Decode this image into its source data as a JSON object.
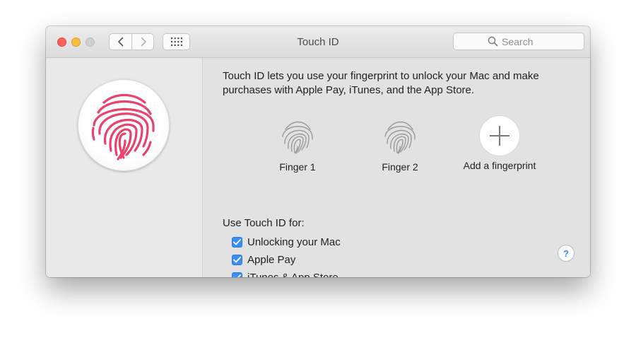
{
  "window": {
    "title": "Touch ID"
  },
  "toolbar": {
    "back_icon": "chevron-left-icon",
    "forward_icon": "chevron-right-icon",
    "grid_icon": "grid-icon"
  },
  "search": {
    "placeholder": "Search"
  },
  "main": {
    "description": "Touch ID lets you use your fingerprint to unlock your Mac and make purchases with Apple Pay, iTunes, and the App Store.",
    "fingerprints": [
      {
        "label": "Finger 1"
      },
      {
        "label": "Finger 2"
      }
    ],
    "add_label": "Add a fingerprint",
    "use_label": "Use Touch ID for:",
    "options": [
      {
        "label": "Unlocking your Mac",
        "checked": true
      },
      {
        "label": "Apple Pay",
        "checked": true
      },
      {
        "label": "iTunes & App Store",
        "checked": true
      }
    ],
    "help_label": "?"
  },
  "colors": {
    "accent": "#3b8ef3",
    "fingerprint_brand": "#e8446b",
    "close": "#fc605c",
    "minimize": "#fdbc40"
  }
}
